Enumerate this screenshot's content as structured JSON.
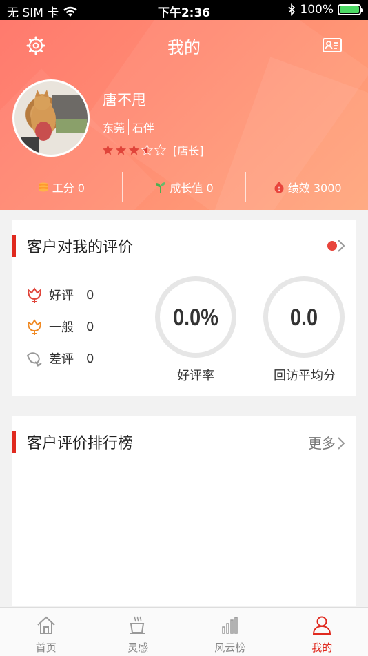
{
  "status_bar": {
    "carrier": "无 SIM 卡",
    "time": "下午2:36",
    "battery": "100%"
  },
  "header": {
    "title": "我的",
    "username": "唐不甩",
    "city": "东莞",
    "district": "石伴",
    "rating_stars": 3.5,
    "role": "[店长]",
    "stats": [
      {
        "label": "工分 0"
      },
      {
        "label": "成长值 0"
      },
      {
        "label": "绩效 3000"
      }
    ]
  },
  "reviews_card": {
    "title": "客户对我的评价",
    "items": [
      {
        "label": "好评",
        "count": "0"
      },
      {
        "label": "一般",
        "count": "0"
      },
      {
        "label": "差评",
        "count": "0"
      }
    ],
    "good_rate": "0.0%",
    "good_rate_label": "好评率",
    "avg_score": "0.0",
    "avg_score_label": "回访平均分"
  },
  "ranking_card": {
    "title": "客户评价排行榜",
    "more_label": "更多"
  },
  "tabs": [
    {
      "label": "首页",
      "icon": "home-icon"
    },
    {
      "label": "灵感",
      "icon": "cup-icon"
    },
    {
      "label": "风云榜",
      "icon": "bar-chart-icon"
    },
    {
      "label": "我的",
      "icon": "person-icon"
    }
  ],
  "colors": {
    "accent": "#e02a1f",
    "header_start": "#ff7a6e",
    "header_end": "#ffa57a"
  }
}
